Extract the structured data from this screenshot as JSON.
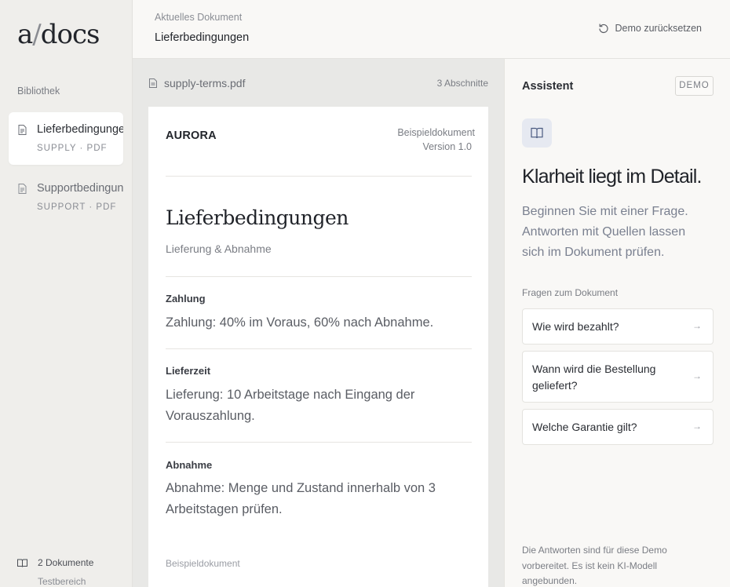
{
  "app": {
    "logo_a": "a",
    "logo_slash": "/",
    "logo_docs": "docs"
  },
  "sidebar": {
    "library_label": "Bibliothek",
    "items": [
      {
        "title": "Lieferbedingungen",
        "subtitle": "SUPPLY · PDF",
        "icon": "file-icon",
        "active": true
      },
      {
        "title": "Supportbedingungen",
        "subtitle": "SUPPORT · PDF",
        "icon": "file-icon",
        "active": false
      }
    ],
    "footer": {
      "count": "2 Dokumente",
      "space": "Testbereich",
      "icon": "book-icon"
    }
  },
  "topbar": {
    "kicker": "Aktuelles Dokument",
    "title": "Lieferbedingungen",
    "reset_label": "Demo zurücksetzen",
    "reset_icon": "reset-icon"
  },
  "viewer": {
    "filename": "supply-terms.pdf",
    "sections_count": "3 Abschnitte",
    "document": {
      "brand": "AURORA",
      "meta_line1": "Beispieldokument",
      "meta_line2": "Version 1.0",
      "heading": "Lieferbedingungen",
      "subheading": "Lieferung & Abnahme",
      "sections": [
        {
          "label": "Zahlung",
          "text": "Zahlung: 40% im Voraus, 60% nach Abnahme."
        },
        {
          "label": "Lieferzeit",
          "text": "Lieferung: 10 Arbeitstage nach Eingang der Vorauszahlung."
        },
        {
          "label": "Abnahme",
          "text": "Abnahme: Menge und Zustand innerhalb von 3 Arbeitstagen prüfen."
        }
      ],
      "footer": "Beispieldokument"
    }
  },
  "assistant": {
    "title": "Assistent",
    "badge": "DEMO",
    "headline": "Klarheit liegt im Detail.",
    "intro": "Beginnen Sie mit einer Frage. Antworten mit Quellen lassen sich im Dokument prüfen.",
    "questions_label": "Fragen zum Dokument",
    "questions": [
      {
        "text": "Wie wird bezahlt?",
        "arrow": "→"
      },
      {
        "text": "Wann wird die Bestellung geliefert?",
        "arrow": "→"
      },
      {
        "text": "Welche Garantie gilt?",
        "arrow": "→"
      }
    ],
    "disclaimer": "Die Antworten sind für diese Demo vorbereitet. Es ist kein KI-Modell angebunden."
  },
  "colors": {
    "accent_icon_bg": "#e6e9f1",
    "accent_icon": "#4a5a80",
    "sidebar_bg": "#efeeeb",
    "viewer_bg": "#e8e8e6"
  }
}
